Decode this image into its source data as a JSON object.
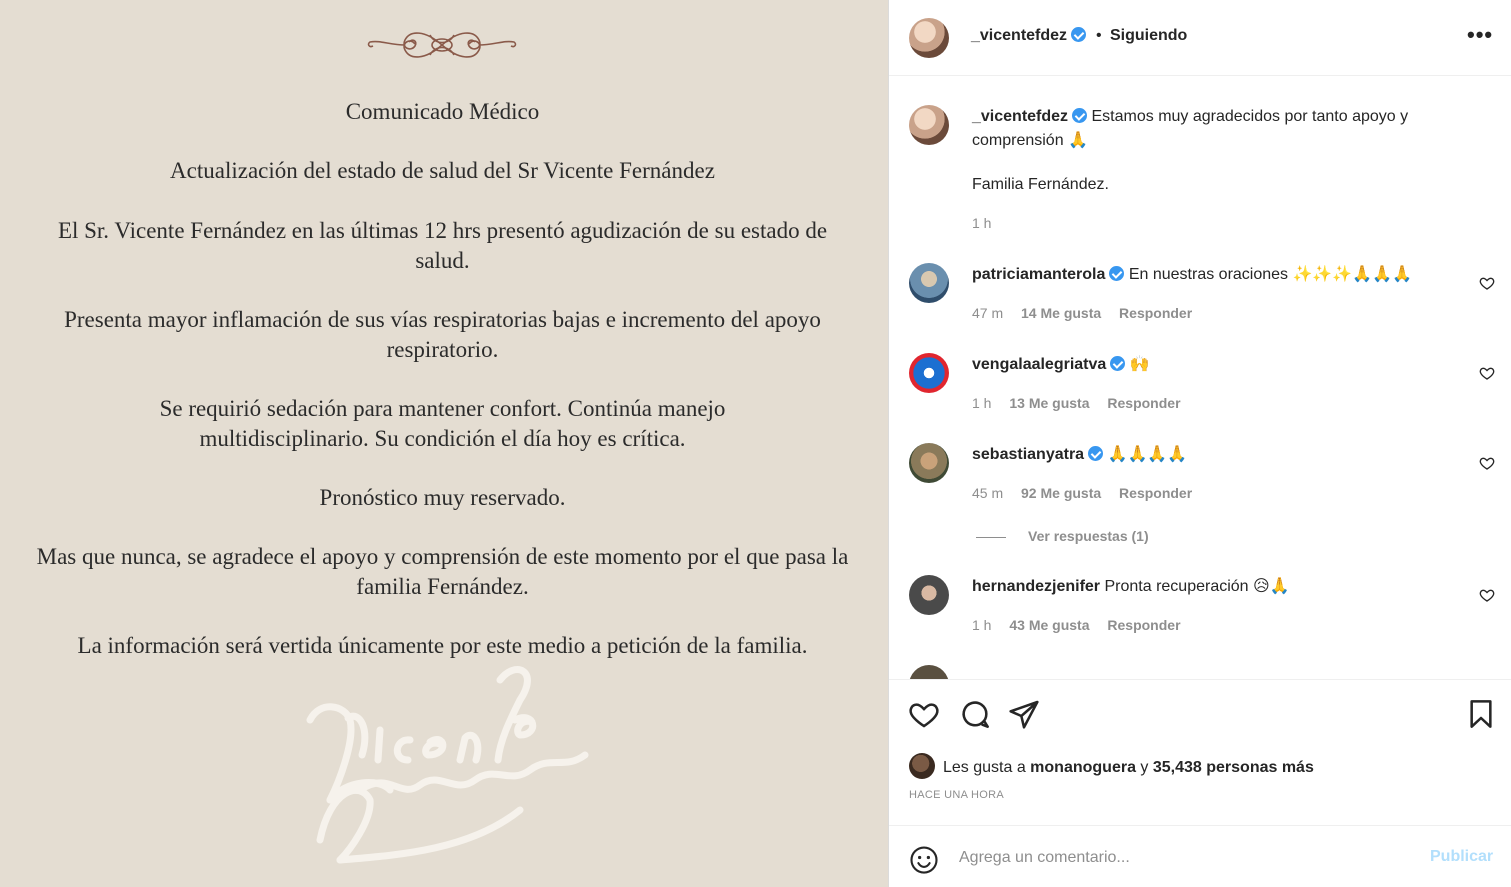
{
  "post": {
    "document_lines": [
      "Comunicado Médico",
      "Actualización del estado de salud del Sr Vicente Fernández",
      "El Sr. Vicente Fernández en las últimas 12 hrs presentó agudización de su estado de salud.",
      "Presenta mayor inflamación de sus vías respiratorias bajas e incremento del apoyo respiratorio.",
      "Se requirió sedación para mantener confort. Continúa manejo multidisciplinario. Su condición el día hoy es crítica.",
      "Pronóstico muy reservado.",
      "Mas que nunca, se agradece el apoyo y comprensión de este momento por el que pasa la familia Fernández.",
      "La información será vertida únicamente por este medio a petición de la familia."
    ],
    "signature_text": "Vicente Fernandez"
  },
  "header": {
    "username": "_vicentefdez",
    "separator": "•",
    "follow_status": "Siguiendo",
    "more_icon": "more-horizontal-icon"
  },
  "caption": {
    "username": "_vicentefdez",
    "text": "Estamos muy agradecidos por tanto apoyo y comprensión 🙏",
    "signoff": "Familia Fernández.",
    "time": "1 h"
  },
  "comments": [
    {
      "username": "patriciamanterola",
      "text": "En nuestras oraciones ✨✨✨🙏🙏🙏",
      "time": "47 m",
      "likes": "14 Me gusta",
      "reply": "Responder",
      "avatar_color": "#6a8fae"
    },
    {
      "username": "vengalaalegriatva",
      "text": "🙌",
      "time": "1 h",
      "likes": "13 Me gusta",
      "reply": "Responder",
      "avatar_color": "#1c6fd1"
    },
    {
      "username": "sebastianyatra",
      "text": "🙏🙏🙏🙏",
      "time": "45 m",
      "likes": "92 Me gusta",
      "reply": "Responder",
      "avatar_color": "#8a7a5a"
    },
    {
      "username": "hernandezjenifer",
      "text": "Pronta recuperación 😥🙏",
      "time": "1 h",
      "likes": "43 Me gusta",
      "reply": "Responder",
      "avatar_color": "#4a4a4a"
    }
  ],
  "view_replies": "Ver respuestas (1)",
  "actions": {
    "icons": [
      "heart-icon",
      "comment-icon",
      "share-icon",
      "bookmark-icon"
    ]
  },
  "likes": {
    "prefix": "Les gusta a ",
    "user": "monanoguera",
    "middle": " y ",
    "count": "35,438 personas más"
  },
  "time_ago": "HACE UNA HORA",
  "composer": {
    "placeholder": "Agrega un comentario...",
    "publish_label": "Publicar"
  },
  "colors": {
    "image_bg": "#e4ddd2",
    "verified": "#3897f0",
    "publish_disabled": "#b2dffc",
    "muted_text": "#8e8e8e"
  }
}
